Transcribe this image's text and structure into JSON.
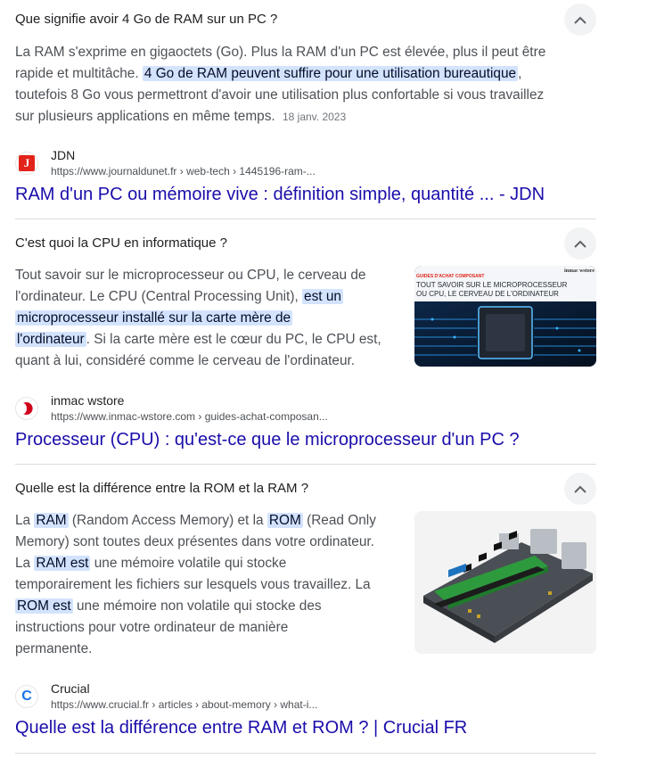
{
  "items": [
    {
      "question": "Que signifie avoir 4 Go de RAM sur un PC ?",
      "answer": {
        "l1": "La RAM s'exprime en gigaoctets (Go). Plus la RAM d'un PC est élevée, plus il peut être",
        "l2a": "rapide et multitâche.",
        "l2hl": "4 Go de RAM peuvent suffire pour une utilisation bureautique",
        "l2b": ",",
        "l3": "toutefois 8 Go vous permettront d'avoir une utilisation plus confortable si vous travaillez",
        "l4": "sur plusieurs applications en même temps.",
        "date": "18 janv. 2023"
      },
      "source": {
        "name": "JDN",
        "url": "https://www.journaldunet.fr › web-tech › 1445196-ram-...",
        "favicon_letter": "J",
        "favicon_color": "#e2231a"
      },
      "title": "RAM d'un PC ou mémoire vive : définition simple, quantité ... - JDN"
    },
    {
      "question": "C'est quoi la CPU en informatique ?",
      "answer": {
        "l1": "Tout savoir sur le microprocesseur ou CPU, le cerveau de",
        "l2a": "l'ordinateur. Le CPU (Central Processing Unit),",
        "l2hl": "est un",
        "l3hl": "microprocesseur installé sur la carte mère de",
        "l4hl": "l'ordinateur",
        "l4b": ". Si la carte mère est le cœur du PC, le CPU est,",
        "l5": "quant à lui, considéré comme le cerveau de l'ordinateur."
      },
      "thumb": {
        "tag": "GUIDES D'ACHAT COMPOSANT",
        "caption1": "TOUT SAVOIR SUR LE MICROPROCESSEUR",
        "caption2": "OU CPU, LE CERVEAU DE L'ORDINATEUR",
        "brand": "inmac wstore"
      },
      "source": {
        "name": "inmac wstore",
        "url": "https://www.inmac-wstore.com › guides-achat-composan...",
        "favicon_color": "#d0021b"
      },
      "title": "Processeur (CPU) : qu'est-ce que le microprocesseur d'un PC ?"
    },
    {
      "question": "Quelle est la différence entre la ROM et la RAM ?",
      "answer": {
        "l1a": "La",
        "l1hl1": "RAM",
        "l1b": "(Random Access Memory) et la",
        "l1hl2": "ROM",
        "l1c": "(Read Only",
        "l2": "Memory) sont toutes deux présentes dans votre ordinateur.",
        "l3a": "La",
        "l3hl": "RAM est",
        "l3b": "une mémoire volatile qui stocke",
        "l4": "temporairement les fichiers sur lesquels vous travaillez. La",
        "l5hl": "ROM est",
        "l5b": "une mémoire non volatile qui stocke des",
        "l6": "instructions pour votre ordinateur de manière",
        "l7": "permanente."
      },
      "source": {
        "name": "Crucial",
        "url": "https://www.crucial.fr › articles › about-memory › what-i...",
        "favicon_letter": "C",
        "favicon_color": "#1a73e8"
      },
      "title": "Quelle est la différence entre RAM et ROM ? | Crucial FR"
    }
  ]
}
